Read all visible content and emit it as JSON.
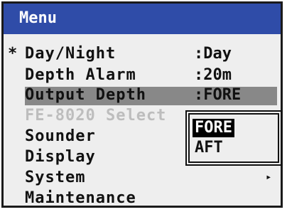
{
  "window": {
    "title": "Menu"
  },
  "menu_items": [
    {
      "mark": "*",
      "label": "Day/Night",
      "value": ":Day"
    },
    {
      "mark": "",
      "label": "Depth Alarm",
      "value": ":20m"
    },
    {
      "mark": "",
      "label": "Output Depth",
      "value": ":FORE"
    },
    {
      "mark": "",
      "label": "FE-8020 Select",
      "value": ""
    },
    {
      "mark": "",
      "label": "Sounder",
      "value": ""
    },
    {
      "mark": "",
      "label": "Display",
      "value": ""
    },
    {
      "mark": "",
      "label": "System",
      "value": ""
    },
    {
      "mark": "",
      "label": "Maintenance",
      "value": ""
    }
  ],
  "system_submenu_arrow": "▸",
  "popup": {
    "options": [
      "FORE",
      "AFT"
    ],
    "selected": "FORE"
  },
  "colors": {
    "title_bar": "#2f4ca8",
    "selected_row": "#888888",
    "disabled_text": "#bdbdbd"
  }
}
